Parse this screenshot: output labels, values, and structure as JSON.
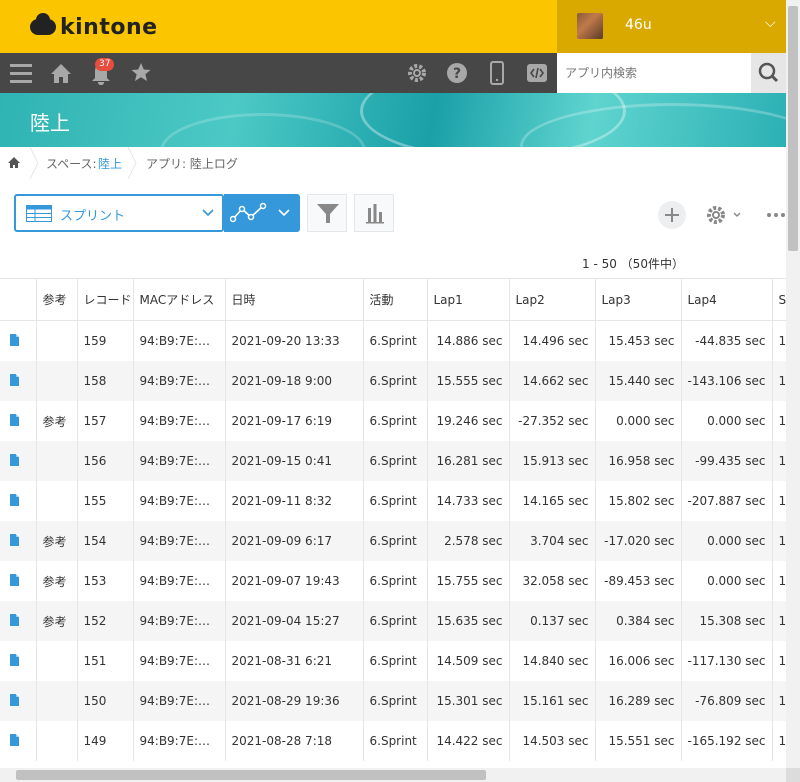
{
  "app": {
    "logo_text": "kintone",
    "username": "46u",
    "notification_count": "37"
  },
  "search": {
    "placeholder": "アプリ内検索"
  },
  "space": {
    "title": "陸上"
  },
  "breadcrumb": {
    "space_label": "スペース: ",
    "space_link": "陸上",
    "app_label": "アプリ: 陸上ログ"
  },
  "view": {
    "name": "スプリント"
  },
  "pagination": {
    "text": "1 - 50 （50件中）"
  },
  "table": {
    "headers": [
      "参考",
      "レコード",
      "MACアドレス",
      "日時",
      "活動",
      "Lap1",
      "Lap2",
      "Lap3",
      "Lap4",
      "S"
    ],
    "rows": [
      {
        "ref": "",
        "record": "159",
        "mac": "94:B9:7E:…",
        "datetime": "2021-09-20 13:33",
        "activity": "6.Sprint",
        "lap1": "14.886 sec",
        "lap2": "14.496 sec",
        "lap3": "15.453 sec",
        "lap4": "-44.835 sec",
        "s": "1"
      },
      {
        "ref": "",
        "record": "158",
        "mac": "94:B9:7E:…",
        "datetime": "2021-09-18 9:00",
        "activity": "6.Sprint",
        "lap1": "15.555 sec",
        "lap2": "14.662 sec",
        "lap3": "15.440 sec",
        "lap4": "-143.106 sec",
        "s": "1"
      },
      {
        "ref": "参考",
        "record": "157",
        "mac": "94:B9:7E:…",
        "datetime": "2021-09-17 6:19",
        "activity": "6.Sprint",
        "lap1": "19.246 sec",
        "lap2": "-27.352 sec",
        "lap3": "0.000 sec",
        "lap4": "0.000 sec",
        "s": "1"
      },
      {
        "ref": "",
        "record": "156",
        "mac": "94:B9:7E:…",
        "datetime": "2021-09-15 0:41",
        "activity": "6.Sprint",
        "lap1": "16.281 sec",
        "lap2": "15.913 sec",
        "lap3": "16.958 sec",
        "lap4": "-99.435 sec",
        "s": "1"
      },
      {
        "ref": "",
        "record": "155",
        "mac": "94:B9:7E:…",
        "datetime": "2021-09-11 8:32",
        "activity": "6.Sprint",
        "lap1": "14.733 sec",
        "lap2": "14.165 sec",
        "lap3": "15.802 sec",
        "lap4": "-207.887 sec",
        "s": "1"
      },
      {
        "ref": "参考",
        "record": "154",
        "mac": "94:B9:7E:…",
        "datetime": "2021-09-09 6:17",
        "activity": "6.Sprint",
        "lap1": "2.578 sec",
        "lap2": "3.704 sec",
        "lap3": "-17.020 sec",
        "lap4": "0.000 sec",
        "s": "1"
      },
      {
        "ref": "参考",
        "record": "153",
        "mac": "94:B9:7E:…",
        "datetime": "2021-09-07 19:43",
        "activity": "6.Sprint",
        "lap1": "15.755 sec",
        "lap2": "32.058 sec",
        "lap3": "-89.453 sec",
        "lap4": "0.000 sec",
        "s": "1"
      },
      {
        "ref": "参考",
        "record": "152",
        "mac": "94:B9:7E:…",
        "datetime": "2021-09-04 15:27",
        "activity": "6.Sprint",
        "lap1": "15.635 sec",
        "lap2": "0.137 sec",
        "lap3": "0.384 sec",
        "lap4": "15.308 sec",
        "s": "1"
      },
      {
        "ref": "",
        "record": "151",
        "mac": "94:B9:7E:…",
        "datetime": "2021-08-31 6:21",
        "activity": "6.Sprint",
        "lap1": "14.509 sec",
        "lap2": "14.840 sec",
        "lap3": "16.006 sec",
        "lap4": "-117.130 sec",
        "s": "1"
      },
      {
        "ref": "",
        "record": "150",
        "mac": "94:B9:7E:…",
        "datetime": "2021-08-29 19:36",
        "activity": "6.Sprint",
        "lap1": "15.301 sec",
        "lap2": "15.161 sec",
        "lap3": "16.289 sec",
        "lap4": "-76.809 sec",
        "s": "1"
      },
      {
        "ref": "",
        "record": "149",
        "mac": "94:B9:7E:…",
        "datetime": "2021-08-28 7:18",
        "activity": "6.Sprint",
        "lap1": "14.422 sec",
        "lap2": "14.503 sec",
        "lap3": "15.551 sec",
        "lap4": "-165.192 sec",
        "s": "1"
      }
    ]
  },
  "colors": {
    "brand_yellow": "#fbc500",
    "nav_dark": "#474747",
    "accent_blue": "#3498db"
  }
}
